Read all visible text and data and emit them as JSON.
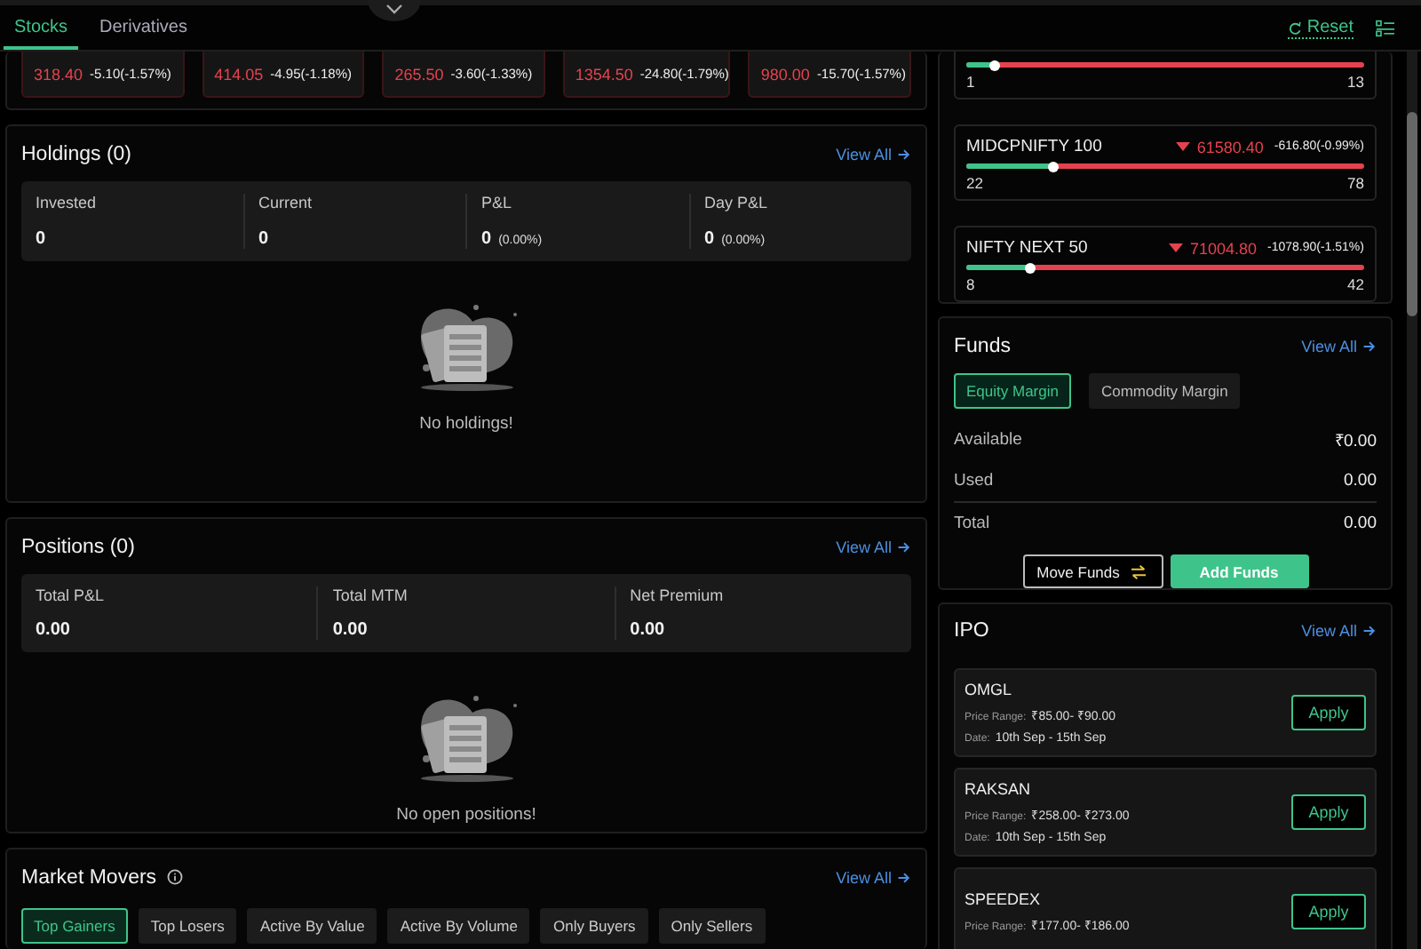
{
  "tabs": [
    {
      "label": "Stocks",
      "selected": true
    },
    {
      "label": "Derivatives",
      "selected": false
    }
  ],
  "reset": "Reset",
  "stock_strip": [
    {
      "price": "318.40",
      "change": "-5.10(-1.57%)",
      "kind": "falling"
    },
    {
      "price": "414.05",
      "change": "-4.95(-1.18%)",
      "kind": "falling"
    },
    {
      "price": "265.50",
      "change": "-3.60(-1.33%)",
      "kind": "falling"
    },
    {
      "price": "1354.50",
      "change": "-24.80(-1.79%)",
      "kind": "falling"
    },
    {
      "price": "980.00",
      "change": "-15.70(-1.57%)",
      "kind": "falling"
    }
  ],
  "holdings": {
    "title": "Holdings (0)",
    "view_all": "View All",
    "stats": [
      {
        "label": "Invested",
        "value": "0"
      },
      {
        "label": "Current",
        "value": "0"
      },
      {
        "label": "P&L",
        "value": "0",
        "sub": "(0.00%)"
      },
      {
        "label": "Day P&L",
        "value": "0",
        "sub": "(0.00%)"
      }
    ],
    "empty_text": "No holdings!"
  },
  "positions": {
    "title": "Positions (0)",
    "view_all": "View All",
    "stats": [
      {
        "label": "Total P&L",
        "value": "0.00"
      },
      {
        "label": "Total MTM",
        "value": "0.00"
      },
      {
        "label": "Net Premium",
        "value": "0.00"
      }
    ],
    "empty_text": "No open positions!"
  },
  "market_movers": {
    "title": "Market Movers",
    "view_all": "View All",
    "filters": [
      {
        "label": "Top Gainers",
        "selected": true
      },
      {
        "label": "Top Losers",
        "selected": false
      },
      {
        "label": "Active By Value",
        "selected": false
      },
      {
        "label": "Active By Volume",
        "selected": false
      },
      {
        "label": "Only Buyers",
        "selected": false
      },
      {
        "label": "Only Sellers",
        "selected": false
      }
    ]
  },
  "indices": [
    {
      "level": 0.07,
      "advances": "1",
      "declines": "13"
    },
    {
      "name": "MIDCPNIFTY 100",
      "kind": "falling",
      "price": "61580.40",
      "change": "-616.80(-0.99%)",
      "level": 0.22,
      "advances": "22",
      "declines": "78"
    },
    {
      "name": "NIFTY NEXT 50",
      "kind": "falling",
      "price": "71004.80",
      "change": "-1078.90(-1.51%)",
      "level": 0.16,
      "advances": "8",
      "declines": "42"
    }
  ],
  "funds": {
    "title": "Funds",
    "view_all": "View All",
    "tabs": [
      {
        "label": "Equity Margin",
        "selected": true
      },
      {
        "label": "Commodity Margin",
        "selected": false
      }
    ],
    "rows": [
      {
        "label": "Available",
        "value": "₹0.00"
      },
      {
        "label": "Used",
        "value": "0.00"
      },
      {
        "label": "Total",
        "value": "0.00"
      }
    ],
    "move_button": "Move Funds",
    "add_button": "Add Funds"
  },
  "ipo": {
    "title": "IPO",
    "view_all": "View All",
    "items": [
      {
        "name": "OMGL",
        "price_label": "Price Range:",
        "price": "₹85.00- ₹90.00",
        "date_label": "Date:",
        "date": "10th Sep - 15th Sep",
        "action": "Apply"
      },
      {
        "name": "RAKSAN",
        "price_label": "Price Range:",
        "price": "₹258.00- ₹273.00",
        "date_label": "Date:",
        "date": "10th Sep - 15th Sep",
        "action": "Apply"
      },
      {
        "name": "SPEEDEX",
        "price_label": "Price Range:",
        "price": "₹177.00- ₹186.00",
        "action": "Apply"
      }
    ]
  }
}
